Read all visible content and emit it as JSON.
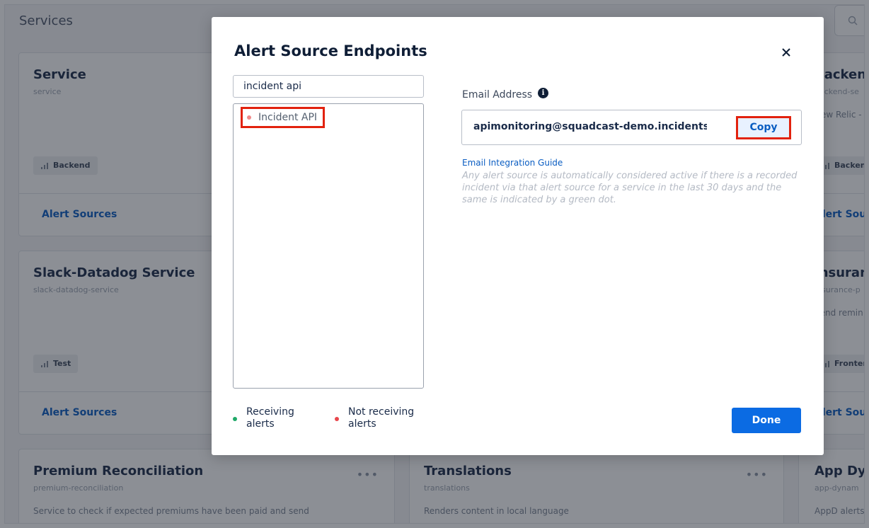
{
  "page": {
    "title": "Services"
  },
  "search": {
    "icon": "search-icon"
  },
  "cards": [
    {
      "title": "Service",
      "subtitle": "service",
      "tag": "Backend",
      "link": "Alert Sources"
    },
    {
      "title": "Slack-Datadog Service",
      "subtitle": "slack-datadog-service",
      "tag": "Test",
      "link": "Alert Sources"
    },
    {
      "title": "Premium Reconciliation",
      "subtitle": "premium-reconciliation",
      "description": "Service to check if expected premiums have been paid and send",
      "menu": "•••"
    },
    {
      "title": "Translations",
      "subtitle": "translations",
      "description": "Renders content in local language",
      "menu": "•••"
    },
    {
      "title": "Backend",
      "subtitle": "backend-se",
      "description": "New Relic -",
      "tag": "Backend",
      "link": "Alert Sources"
    },
    {
      "title": "Insurance",
      "subtitle": "insurance-p",
      "description": "Send remin",
      "tag": "Frontend",
      "link": "Alert Sources"
    },
    {
      "title": "App Dynamics",
      "subtitle": "app-dynam",
      "description": "AppD alerts"
    }
  ],
  "modal": {
    "title": "Alert Source Endpoints",
    "close_icon": "close-icon",
    "filter_value": "incident api",
    "sources": [
      {
        "label": "Incident API",
        "status": "not-receiving"
      }
    ],
    "legend": [
      {
        "label": "Receiving alerts",
        "color": "#1fa968"
      },
      {
        "label": "Not receiving alerts",
        "color": "#e8474c"
      }
    ],
    "email_label": "Email Address",
    "info_icon": "i",
    "email_value": "apimonitoring@squadcast-demo.incidents.squadcast.com",
    "copy_label": "Copy",
    "guide_link": "Email Integration Guide",
    "guide_note": "Any alert source is automatically considered active if there is a recorded incident via that alert source for a service in the last 30 days and the same is indicated by a green dot.",
    "done_label": "Done"
  },
  "colors": {
    "accent": "#0b6be3",
    "link": "#0a5dc2",
    "highlight": "#e2220e",
    "overlay": "rgba(25, 32, 44, 0.50)"
  }
}
